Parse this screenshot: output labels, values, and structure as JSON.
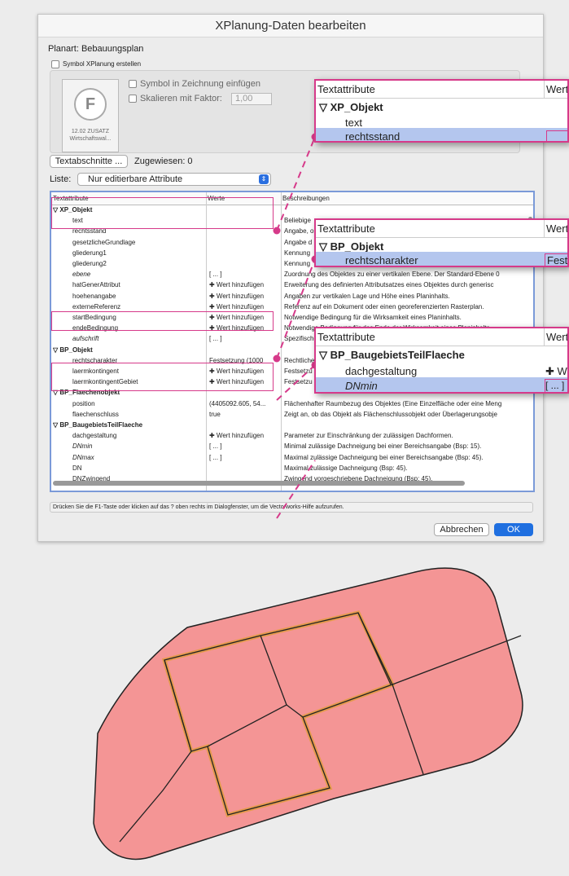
{
  "dialog": {
    "title": "XPlanung-Daten bearbeiten",
    "planart": "Planart: Bebauungsplan",
    "symbol_checkbox": "Symbol XPlanung erstellen",
    "symbol_tile": {
      "letter": "F",
      "line1": "12.02 ZUSATZ",
      "line2": "Wirtschaftswal..."
    },
    "opt_insert": "Symbol in Zeichnung einfügen",
    "opt_scale": "Skalieren mit Faktor:",
    "scale_value": "1,00",
    "textabschnitte_button": "Textabschnitte ...",
    "zugewiesen": "Zugewiesen: 0",
    "liste_label": "Liste:",
    "liste_value": "Nur editierbare Attribute",
    "hint": "Drücken Sie die F1-Taste oder klicken auf das ? oben rechts im Dialogfenster, um die Vectorworks-Hilfe aufzurufen.",
    "cancel": "Abbrechen",
    "ok": "OK"
  },
  "table": {
    "headers": [
      "Textattribute",
      "Werte",
      "Beschreibungen"
    ],
    "rows": [
      {
        "a": "▽  XP_Objekt",
        "w": "",
        "d": "",
        "g": true
      },
      {
        "a": "text",
        "w": "",
        "d": "Beliebige"
      },
      {
        "a": "rechtsstand",
        "w": "",
        "d": "Angabe, o"
      },
      {
        "a": "gesetzlicheGrundlage",
        "w": "",
        "d": "Angabe d"
      },
      {
        "a": "gliederung1",
        "w": "",
        "d": "Kennung"
      },
      {
        "a": "gliederung2",
        "w": "",
        "d": "Kennung"
      },
      {
        "a": "ebene",
        "w": "[ ... ]",
        "d": "Zuordnung des Objektes zu einer vertikalen Ebene. Der Standard-Ebene 0",
        "i": true
      },
      {
        "a": "hatGenerAttribut",
        "w": "✚ Wert hinzufügen",
        "d": "Erweiterung des definierten Attributsatzes eines Objektes durch generisc"
      },
      {
        "a": "hoehenangabe",
        "w": "✚ Wert hinzufügen",
        "d": "Angaben zur vertikalen Lage und Höhe eines Planinhalts."
      },
      {
        "a": "externeReferenz",
        "w": "✚ Wert hinzufügen",
        "d": "Referenz auf ein Dokument oder einen georeferenzierten Rasterplan."
      },
      {
        "a": "startBedingung",
        "w": "✚ Wert hinzufügen",
        "d": "Notwendige Bedingung für die Wirksamkeit eines Planinhalts."
      },
      {
        "a": "endeBedingung",
        "w": "✚ Wert hinzufügen",
        "d": "Notwendige Bedingung für das Ende der Wirksamkeit eines Planinhalts."
      },
      {
        "a": "aufschrift",
        "w": "[ ... ]",
        "d": "Spezifische",
        "i": true
      },
      {
        "a": "▽  BP_Objekt",
        "w": "",
        "d": "",
        "g": true
      },
      {
        "a": "rechtscharakter",
        "w": "Festsetzung (1000",
        "d": "Rechtliche"
      },
      {
        "a": "laermkontingent",
        "w": "✚ Wert hinzufügen",
        "d": "Festsetzu"
      },
      {
        "a": "laermkontingentGebiet",
        "w": "✚ Wert hinzufügen",
        "d": "Festsetzu"
      },
      {
        "a": "▽  BP_Flaechenobjekt",
        "w": "",
        "d": "",
        "g": true
      },
      {
        "a": "position",
        "w": "(4405092.605, 54...",
        "d": "Flächenhafter Raumbezug des Objektes (Eine Einzelfläche oder eine Meng"
      },
      {
        "a": "flaechenschluss",
        "w": "true",
        "d": "Zeigt an, ob das Objekt als Flächenschlussobjekt oder Überlagerungsobje"
      },
      {
        "a": "▽  BP_BaugebietsTeilFlaeche",
        "w": "",
        "d": "",
        "g": true
      },
      {
        "a": "dachgestaltung",
        "w": "✚ Wert hinzufügen",
        "d": "Parameter zur Einschränkung der zulässigen Dachformen."
      },
      {
        "a": "DNmin",
        "w": "[ ... ]",
        "d": "Minimal zulässige Dachneigung bei einer Bereichsangabe (Bsp: 15).",
        "i": true
      },
      {
        "a": "DNmax",
        "w": "[ ... ]",
        "d": "Maximal zulässige Dachneigung bei einer Bereichsangabe (Bsp: 45).",
        "i": true
      },
      {
        "a": "DN",
        "w": "",
        "d": "Maximal zulässige Dachneigung (Bsp: 45)."
      },
      {
        "a": "DNZwingend",
        "w": "",
        "d": "Zwingend vorgeschriebene Dachneigung (Bsp: 45)."
      }
    ]
  },
  "callout1": {
    "h1": "Textattribute",
    "h2": "Werte",
    "g": "XP_Objekt",
    "r1": "text",
    "r2": "rechtsstand"
  },
  "callout2": {
    "h1": "Textattribute",
    "h2": "Werte",
    "g": "BP_Objekt",
    "r1": "rechtscharakter",
    "v1": "Fests"
  },
  "callout3": {
    "h1": "Textattribute",
    "h2": "Werte",
    "g": "BP_BaugebietsTeilFlaeche",
    "r1": "dachgestaltung",
    "v1": "✚ W",
    "r2": "DNmin",
    "v2": "[ ... ]"
  },
  "colors": {
    "accent": "#d63a8a",
    "select": "#b4c6ee",
    "ok": "#1f6fe0",
    "plot": "#f49595",
    "highlight": "#e59a4c"
  }
}
